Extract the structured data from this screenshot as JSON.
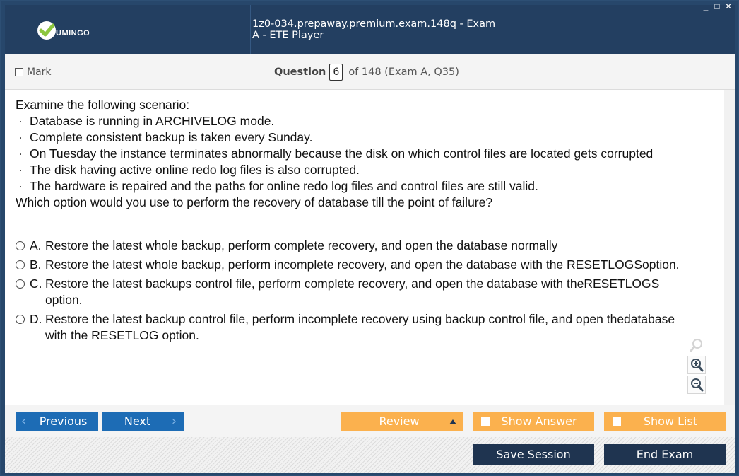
{
  "window": {
    "title": "1z0-034.prepaway.premium.exam.148q - Exam A - ETE Player",
    "logo_text": "UMINGO",
    "controls": [
      "_",
      "□",
      "✕"
    ]
  },
  "question_header": {
    "mark_label": "Mark",
    "question_word": "Question",
    "question_number": "6",
    "of_text": "of 148 (Exam A, Q35)"
  },
  "scenario": {
    "intro": "Examine the following scenario:",
    "bullets": [
      "Database is running in ARCHIVELOG mode.",
      "Complete consistent backup is taken every Sunday.",
      "On Tuesday the instance terminates abnormally because the disk on which control files are located gets corrupted",
      "The disk having active online redo log files is also corrupted.",
      "The hardware is repaired and the paths for online redo log files and control files are still valid."
    ],
    "question": "Which option would you use to perform the recovery of database till the point of failure?"
  },
  "options": [
    {
      "letter": "A.",
      "text": "Restore the latest whole backup, perform complete recovery, and open the database normally"
    },
    {
      "letter": "B.",
      "text": "Restore the latest whole backup, perform incomplete recovery, and open the database with the RESETLOGSoption."
    },
    {
      "letter": "C.",
      "text": "Restore the latest backups control file, perform complete recovery, and open the database with theRESETLOGS option."
    },
    {
      "letter": "D.",
      "text": "Restore the latest backup control file, perform incomplete recovery using backup control file, and open thedatabase with the RESETLOG option."
    }
  ],
  "zoom_icons": [
    "search-icon",
    "zoom-in-icon",
    "zoom-out-icon"
  ],
  "nav": {
    "previous_label": "Previous",
    "next_label": "Next",
    "review_label": "Review",
    "show_answer_label": "Show Answer",
    "show_list_label": "Show List"
  },
  "footer": {
    "save_session_label": "Save Session",
    "end_exam_label": "End Exam"
  },
  "colors": {
    "titlebar": "#233f61",
    "primary_blue": "#1d6cb5",
    "orange": "#fbb14e",
    "dark_button": "#1f3450",
    "logo_check": "#8cc63f"
  }
}
